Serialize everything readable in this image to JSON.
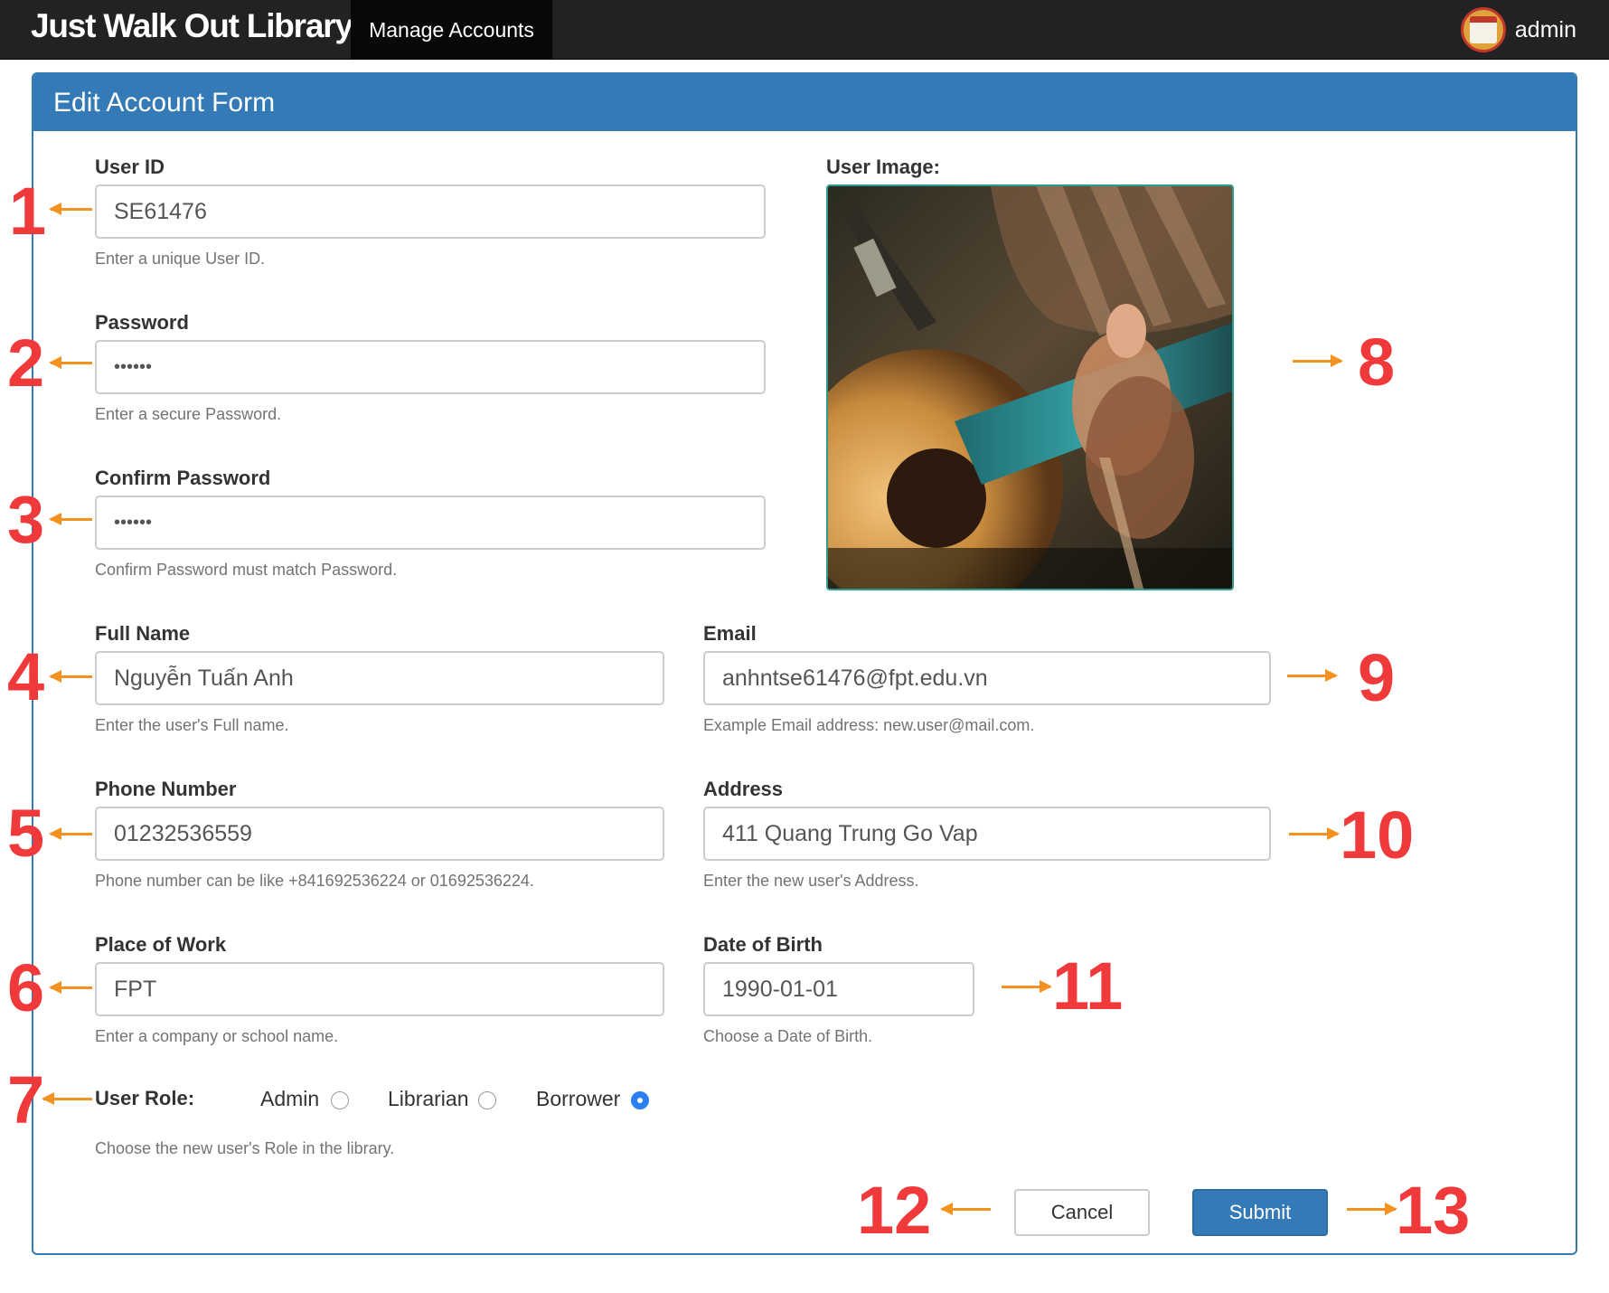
{
  "navbar": {
    "brand": "Just Walk Out Library",
    "active_item": "Manage Accounts",
    "user_name": "admin"
  },
  "form": {
    "title": "Edit Account Form",
    "user_id": {
      "label": "User ID",
      "value": "SE61476",
      "help": "Enter a unique User ID."
    },
    "password": {
      "label": "Password",
      "value": "••••••",
      "help": "Enter a secure Password."
    },
    "confirm_password": {
      "label": "Confirm Password",
      "value": "••••••",
      "help": "Confirm Password must match Password."
    },
    "user_image": {
      "label": "User Image:"
    },
    "full_name": {
      "label": "Full Name",
      "value": "Nguyễn Tuấn Anh",
      "help": "Enter the user's Full name."
    },
    "email": {
      "label": "Email",
      "value": "anhntse61476@fpt.edu.vn",
      "help": "Example Email address: new.user@mail.com."
    },
    "phone": {
      "label": "Phone Number",
      "value": "01232536559",
      "help": "Phone number can be like +841692536224 or 01692536224."
    },
    "address": {
      "label": "Address",
      "value": "411 Quang Trung Go Vap",
      "help": "Enter the new user's Address."
    },
    "place_of_work": {
      "label": "Place of Work",
      "value": "FPT",
      "help": "Enter a company or school name."
    },
    "dob": {
      "label": "Date of Birth",
      "value": "1990-01-01",
      "help": "Choose a Date of Birth."
    },
    "role": {
      "label": "User Role:",
      "options": [
        "Admin",
        "Librarian",
        "Borrower"
      ],
      "selected": "Borrower",
      "help": "Choose the new user's Role in the library."
    },
    "cancel_label": "Cancel",
    "submit_label": "Submit"
  },
  "annotations": [
    "1",
    "2",
    "3",
    "4",
    "5",
    "6",
    "7",
    "8",
    "9",
    "10",
    "11",
    "12",
    "13"
  ],
  "colors": {
    "navbar": "#222222",
    "panel_primary": "#337ab7",
    "annotation_number": "#f0393a",
    "annotation_arrow": "#f39220",
    "radio_checked": "#2b7ff0"
  }
}
